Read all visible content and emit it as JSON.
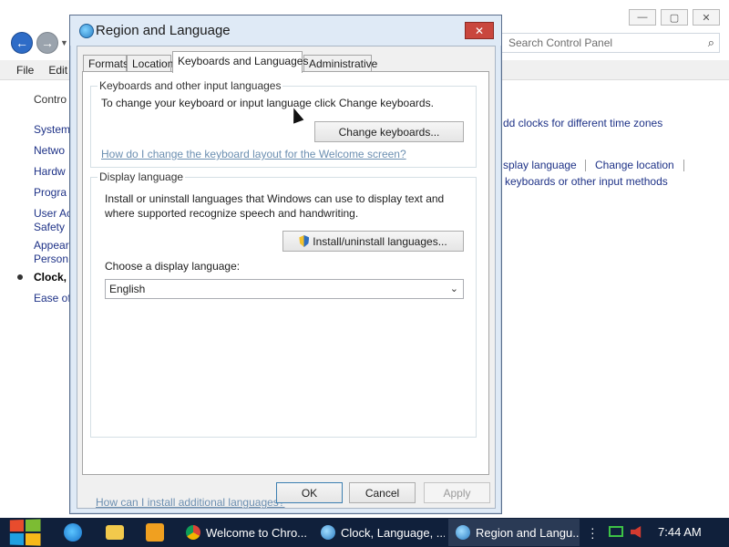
{
  "control_panel": {
    "menu": [
      "File",
      "Edit"
    ],
    "search_placeholder": "Search Control Panel",
    "left_header": "Contro",
    "left_items": [
      "System",
      "Netwo",
      "Hardw",
      "Progra",
      "User Ac",
      "Safety",
      "Appear",
      "Person",
      "Clock, ",
      "Ease of"
    ],
    "current_item": "Clock, ",
    "right_texts": {
      "clocks": "dd clocks for different time zones",
      "display_language": "splay language",
      "change_location": "Change location",
      "keyboards": "keyboards or other input methods"
    }
  },
  "dialog": {
    "title": "Region and Language",
    "close_label": "✕",
    "tabs": [
      "Formats",
      "Location",
      "Keyboards and Languages",
      "Administrative"
    ],
    "active_tab": "Keyboards and Languages",
    "keyboards_group": {
      "label": "Keyboards and other input languages",
      "description": "To change your keyboard or input language click Change keyboards.",
      "button": "Change keyboards...",
      "link": "How do I change the keyboard layout for the Welcome screen?"
    },
    "display_group": {
      "label": "Display language",
      "description_line1": "Install or uninstall languages that Windows can use to display text and",
      "description_line2": "where supported recognize speech and handwriting.",
      "button": "Install/uninstall languages...",
      "choose_label": "Choose a display language:",
      "selected_language": "English"
    },
    "bottom_link": "How can I install additional languages?",
    "buttons": {
      "ok": "OK",
      "cancel": "Cancel",
      "apply": "Apply"
    }
  },
  "taskbar": {
    "items": [
      "Welcome to Chro...",
      "Clock, Language, ...",
      "Region and Langu..."
    ],
    "active_item": "Region and Langu...",
    "time": "7:44 AM"
  }
}
